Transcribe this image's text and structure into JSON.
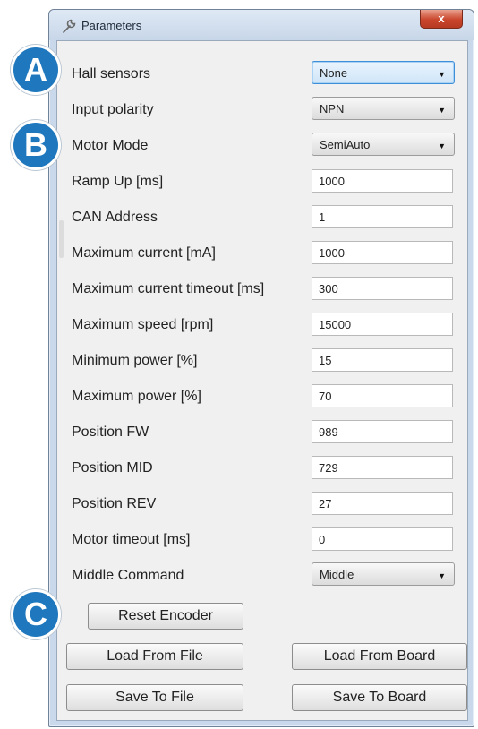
{
  "window": {
    "title": "Parameters",
    "close_label": "x"
  },
  "badges": [
    "A",
    "B",
    "C"
  ],
  "params": [
    {
      "label": "Hall sensors",
      "type": "select",
      "value": "None",
      "focused": true
    },
    {
      "label": "Input polarity",
      "type": "select",
      "value": "NPN"
    },
    {
      "label": "Motor Mode",
      "type": "select",
      "value": "SemiAuto"
    },
    {
      "label": "Ramp Up [ms]",
      "type": "text",
      "value": "1000"
    },
    {
      "label": "CAN Address",
      "type": "text",
      "value": "1"
    },
    {
      "label": "Maximum current [mA]",
      "type": "text",
      "value": "1000"
    },
    {
      "label": "Maximum current timeout [ms]",
      "type": "text",
      "value": "300"
    },
    {
      "label": "Maximum speed [rpm]",
      "type": "text",
      "value": "15000"
    },
    {
      "label": "Minimum power [%]",
      "type": "text",
      "value": "15"
    },
    {
      "label": "Maximum power [%]",
      "type": "text",
      "value": "70"
    },
    {
      "label": "Position FW",
      "type": "text",
      "value": "989"
    },
    {
      "label": "Position MID",
      "type": "text",
      "value": "729"
    },
    {
      "label": "Position REV",
      "type": "text",
      "value": "27"
    },
    {
      "label": "Motor timeout  [ms]",
      "type": "text",
      "value": "0"
    },
    {
      "label": "Middle Command",
      "type": "select",
      "value": "Middle"
    }
  ],
  "buttons": {
    "reset_encoder": "Reset Encoder",
    "load_from_file": "Load From File",
    "load_from_board": "Load From Board",
    "save_to_file": "Save To File",
    "save_to_board": "Save To Board"
  },
  "colors": {
    "badge": "#1f78be",
    "focus": "#3c8fd8",
    "close": "#c9462c"
  }
}
